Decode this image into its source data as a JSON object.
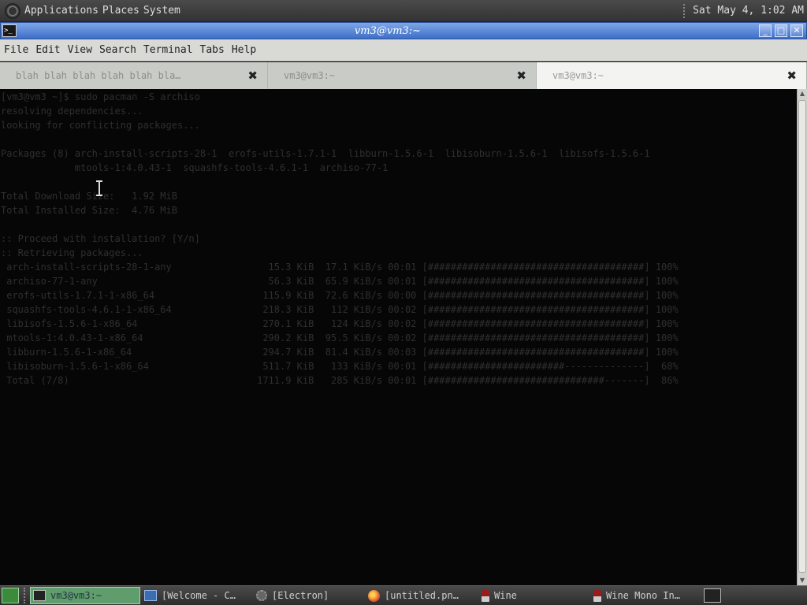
{
  "top_panel": {
    "menus": [
      "Applications",
      "Places",
      "System"
    ],
    "clock": "Sat May  4,  1:02 AM"
  },
  "window": {
    "title": "vm3@vm3:~",
    "icon_label": ">_"
  },
  "menubar": [
    "File",
    "Edit",
    "View",
    "Search",
    "Terminal",
    "Tabs",
    "Help"
  ],
  "tabs": [
    {
      "label": "blah blah blah blah blah bla…",
      "active": false
    },
    {
      "label": "vm3@vm3:~",
      "active": false
    },
    {
      "label": "vm3@vm3:~",
      "active": true
    }
  ],
  "terminal_lines": [
    "[vm3@vm3 ~]$ sudo pacman -S archiso",
    "resolving dependencies...",
    "looking for conflicting packages...",
    "",
    "Packages (8) arch-install-scripts-28-1  erofs-utils-1.7.1-1  libburn-1.5.6-1  libisoburn-1.5.6-1  libisofs-1.5.6-1",
    "             mtools-1:4.0.43-1  squashfs-tools-4.6.1-1  archiso-77-1",
    "",
    "Total Download Size:   1.92 MiB",
    "Total Installed Size:  4.76 MiB",
    "",
    ":: Proceed with installation? [Y/n]",
    ":: Retrieving packages...",
    " arch-install-scripts-28-1-any                 15.3 KiB  17.1 KiB/s 00:01 [######################################] 100%",
    " archiso-77-1-any                              56.3 KiB  65.9 KiB/s 00:01 [######################################] 100%",
    " erofs-utils-1.7.1-1-x86_64                   115.9 KiB  72.6 KiB/s 00:00 [######################################] 100%",
    " squashfs-tools-4.6.1-1-x86_64                218.3 KiB   112 KiB/s 00:02 [######################################] 100%",
    " libisofs-1.5.6-1-x86_64                      270.1 KiB   124 KiB/s 00:02 [######################################] 100%",
    " mtools-1:4.0.43-1-x86_64                     290.2 KiB  95.5 KiB/s 00:02 [######################################] 100%",
    " libburn-1.5.6-1-x86_64                       294.7 KiB  81.4 KiB/s 00:03 [######################################] 100%",
    " libisoburn-1.5.6-1-x86_64                    511.7 KiB   133 KiB/s 00:01 [########################--------------]  68%",
    " Total (7/8)                                 1711.9 KiB   285 KiB/s 00:01 [###############################-------]  86%"
  ],
  "taskbar": {
    "tasks": [
      {
        "label": "vm3@vm3:~",
        "icon": "terminal-icon",
        "active": true
      },
      {
        "label": "[Welcome - C…",
        "icon": "document-icon",
        "active": false
      },
      {
        "label": "[Electron]",
        "icon": "gear-icon",
        "active": false
      },
      {
        "label": "[untitled.pn…",
        "icon": "firefox-icon",
        "active": false
      },
      {
        "label": "Wine",
        "icon": "wine-icon",
        "active": false
      },
      {
        "label": "Wine Mono In…",
        "icon": "wine-icon",
        "active": false
      }
    ]
  }
}
